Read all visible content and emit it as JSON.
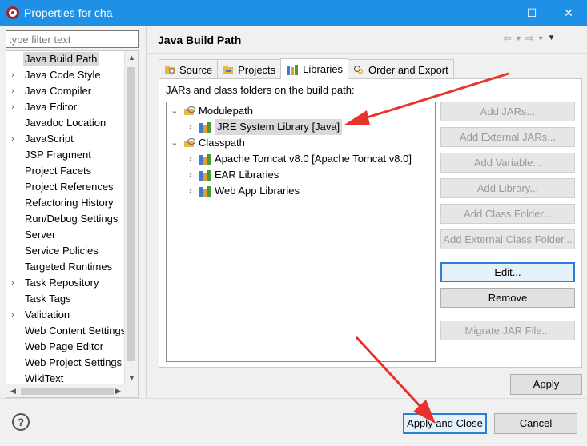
{
  "window": {
    "title": "Properties for cha",
    "maximize_glyph": "☐",
    "close_glyph": "✕"
  },
  "filter": {
    "placeholder": "type filter text"
  },
  "left_tree": {
    "items": [
      {
        "label": "Java Build Path",
        "expandable": false,
        "selected": true
      },
      {
        "label": "Java Code Style",
        "expandable": true
      },
      {
        "label": "Java Compiler",
        "expandable": true
      },
      {
        "label": "Java Editor",
        "expandable": true
      },
      {
        "label": "Javadoc Location",
        "expandable": false
      },
      {
        "label": "JavaScript",
        "expandable": true
      },
      {
        "label": "JSP Fragment",
        "expandable": false
      },
      {
        "label": "Project Facets",
        "expandable": false
      },
      {
        "label": "Project References",
        "expandable": false
      },
      {
        "label": "Refactoring History",
        "expandable": false
      },
      {
        "label": "Run/Debug Settings",
        "expandable": false
      },
      {
        "label": "Server",
        "expandable": false
      },
      {
        "label": "Service Policies",
        "expandable": false
      },
      {
        "label": "Targeted Runtimes",
        "expandable": false
      },
      {
        "label": "Task Repository",
        "expandable": true
      },
      {
        "label": "Task Tags",
        "expandable": false
      },
      {
        "label": "Validation",
        "expandable": true
      },
      {
        "label": "Web Content Settings",
        "expandable": false
      },
      {
        "label": "Web Page Editor",
        "expandable": false
      },
      {
        "label": "Web Project Settings",
        "expandable": false
      },
      {
        "label": "WikiText",
        "expandable": false
      }
    ]
  },
  "page": {
    "title": "Java Build Path"
  },
  "tabs": [
    {
      "label": "Source",
      "active": false
    },
    {
      "label": "Projects",
      "active": false
    },
    {
      "label": "Libraries",
      "active": true
    },
    {
      "label": "Order and Export",
      "active": false
    }
  ],
  "libraries": {
    "label": "JARs and class folders on the build path:",
    "tree": {
      "modulepath": "Modulepath",
      "jre": "JRE System Library [Java]",
      "classpath": "Classpath",
      "tomcat": "Apache Tomcat v8.0 [Apache Tomcat v8.0]",
      "ear": "EAR Libraries",
      "webapp": "Web App Libraries"
    },
    "buttons": {
      "add_jars": "Add JARs...",
      "add_external_jars": "Add External JARs...",
      "add_variable": "Add Variable...",
      "add_library": "Add Library...",
      "add_class_folder": "Add Class Folder...",
      "add_external_class_folder": "Add External Class Folder...",
      "edit": "Edit...",
      "remove": "Remove",
      "migrate": "Migrate JAR File..."
    }
  },
  "footer": {
    "apply": "Apply",
    "apply_and_close": "Apply and Close",
    "cancel": "Cancel",
    "help_glyph": "?"
  },
  "colors": {
    "titlebar": "#1e90e6",
    "annotation_arrow": "#e8332a"
  }
}
